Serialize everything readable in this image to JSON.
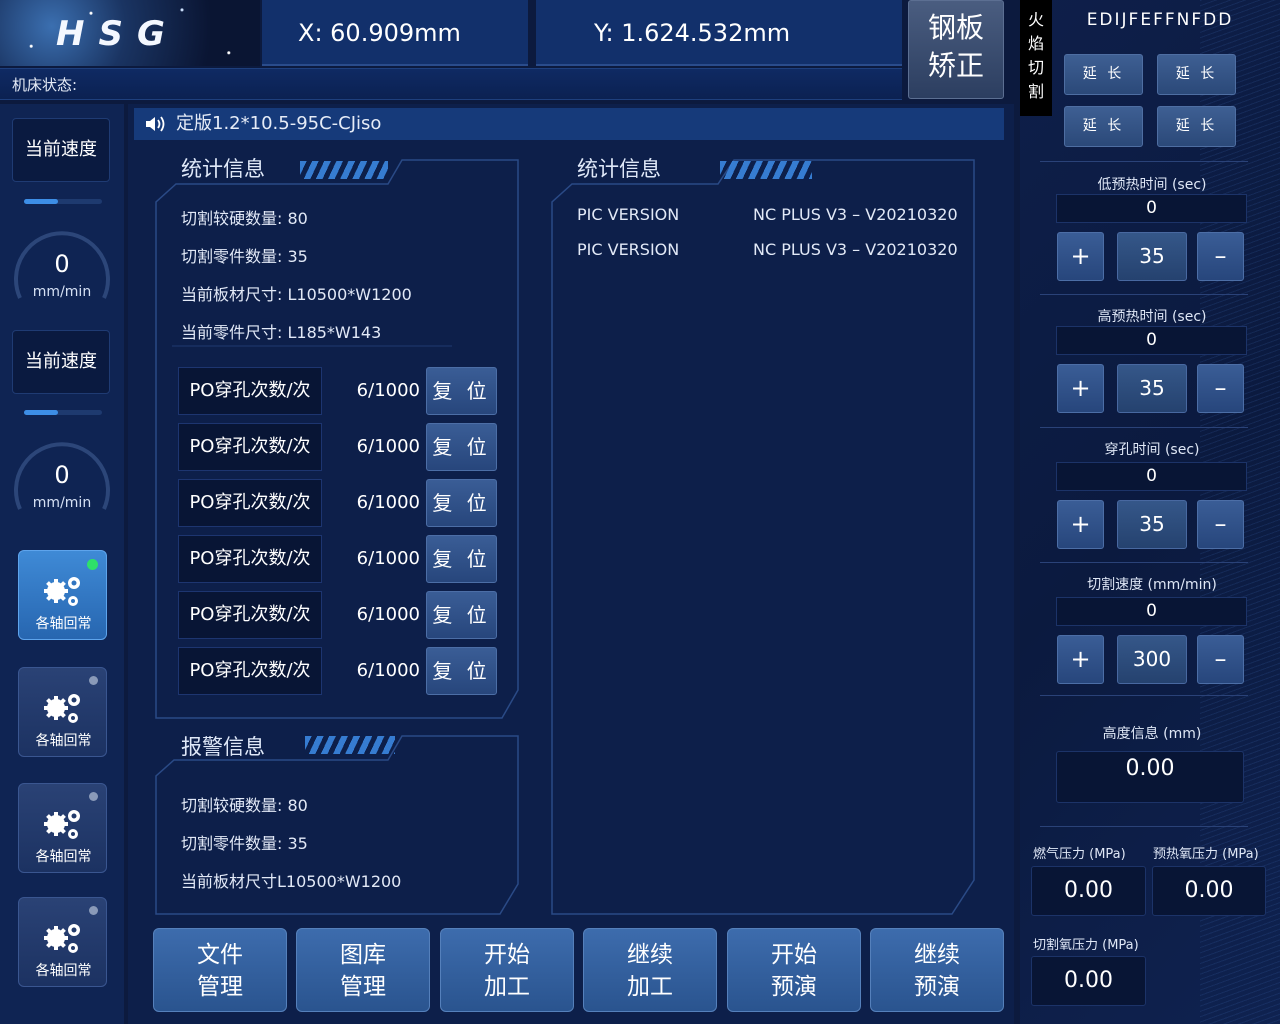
{
  "header": {
    "logo_text": "HSG",
    "x_coord": "X:  60.909mm",
    "y_coord": "Y:  1.624.532mm",
    "machine_status_label": "机床状态:",
    "correction_button": [
      "钢板",
      "矫正"
    ]
  },
  "left_sidebar": {
    "speed_cards": [
      {
        "label": "当前速度",
        "value": "0",
        "unit": "mm/min",
        "level": 0.44
      },
      {
        "label": "当前速度",
        "value": "0",
        "unit": "mm/min",
        "level": 0.44
      }
    ],
    "home_buttons": [
      {
        "label": "各轴回常",
        "active": true
      },
      {
        "label": "各轴回常",
        "active": false
      },
      {
        "label": "各轴回常",
        "active": false
      },
      {
        "label": "各轴回常",
        "active": false
      }
    ]
  },
  "program": {
    "name": "定版1.2*10.5-95C-CJiso"
  },
  "stats_left": {
    "title": "统计信息",
    "lines": [
      "切割较硬数量:  80",
      "切割零件数量:  35",
      "当前板材尺寸:  L10500*W1200",
      "当前零件尺寸:  L185*W143"
    ],
    "pierce_rows": [
      {
        "label": "PO穿孔次数/次",
        "count": "6/1000",
        "reset": "复 位"
      },
      {
        "label": "PO穿孔次数/次",
        "count": "6/1000",
        "reset": "复 位"
      },
      {
        "label": "PO穿孔次数/次",
        "count": "6/1000",
        "reset": "复 位"
      },
      {
        "label": "PO穿孔次数/次",
        "count": "6/1000",
        "reset": "复 位"
      },
      {
        "label": "PO穿孔次数/次",
        "count": "6/1000",
        "reset": "复 位"
      },
      {
        "label": "PO穿孔次数/次",
        "count": "6/1000",
        "reset": "复 位"
      }
    ]
  },
  "alarm": {
    "title": "报警信息",
    "lines": [
      "切割较硬数量:  80",
      "切割零件数量:  35",
      "当前板材尺寸L10500*W1200"
    ]
  },
  "stats_right": {
    "title": "统计信息",
    "rows": [
      {
        "key": "PIC VERSION",
        "value": "NC PLUS V3 – V20210320"
      },
      {
        "key": "PIC VERSION",
        "value": "NC PLUS V3 – V20210320"
      }
    ]
  },
  "bottom_buttons": [
    {
      "line1": "文件",
      "line2": "管理"
    },
    {
      "line1": "图库",
      "line2": "管理"
    },
    {
      "line1": "开始",
      "line2": "加工"
    },
    {
      "line1": "继续",
      "line2": "加工"
    },
    {
      "line1": "开始",
      "line2": "预演"
    },
    {
      "line1": "继续",
      "line2": "预演"
    }
  ],
  "right_panel": {
    "mode_tab": [
      "火",
      "焰",
      "切",
      "割"
    ],
    "code": "EDIJFEFFNFDD",
    "extend_buttons": [
      "延 长",
      "延 长",
      "延 长",
      "延 长"
    ],
    "params": [
      {
        "label": "低预热时间 (sec)",
        "value": "0",
        "step": "35",
        "plus": "+",
        "minus": "–"
      },
      {
        "label": "高预热时间 (sec)",
        "value": "0",
        "step": "35",
        "plus": "+",
        "minus": "–"
      },
      {
        "label": "穿孔时间 (sec)",
        "value": "0",
        "step": "35",
        "plus": "+",
        "minus": "–"
      },
      {
        "label": "切割速度 (mm/min)",
        "value": "0",
        "step": "300",
        "plus": "+",
        "minus": "–"
      }
    ],
    "height_label": "高度信息 (mm)",
    "height_value": "0.00",
    "gas_label": "燃气压力 (MPa)",
    "gas_value": "0.00",
    "preheat_o2_label": "预热氧压力 (MPa)",
    "preheat_o2_value": "0.00",
    "cut_o2_label": "切割氧压力 (MPa)",
    "cut_o2_value": "0.00"
  },
  "colors": {
    "background": "#0c1a3e",
    "accent": "#3a86e0",
    "active_indicator": "#2ee06a"
  }
}
